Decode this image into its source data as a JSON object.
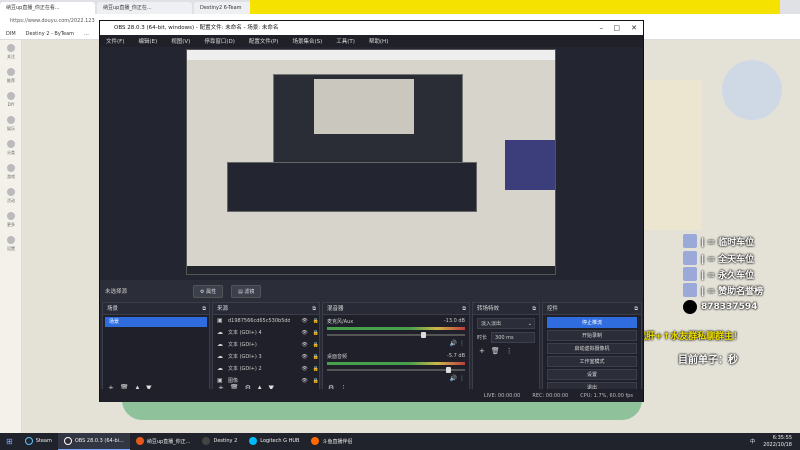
{
  "browser": {
    "tabs": [
      "纳豆up直播_你正在看...",
      "纳豆up直播_你正在...",
      "Destiny2 6-Team"
    ],
    "address": "https://www.douyu.com/2022.123",
    "bookmarks": [
      "DIM",
      "Destiny 2 - ByTeam",
      "..."
    ],
    "sidebar_items": [
      "关注",
      "推荐",
      "DIY",
      "娱乐",
      "分类",
      "游戏",
      "活动",
      "更多",
      "设置"
    ]
  },
  "obs": {
    "title": "OBS 28.0.3 (64-bit, windows) - 配置文件: 未命名 - 场景: 未命名",
    "menu": [
      "文件(F)",
      "编辑(E)",
      "视图(V)",
      "停靠窗口(D)",
      "配置文件(P)",
      "场景集合(S)",
      "工具(T)",
      "帮助(H)"
    ],
    "source_label": "未选择源",
    "toolbar": {
      "props": "属性",
      "filters": "滤镜"
    },
    "scenes": {
      "title": "场景",
      "items": [
        "场景"
      ]
    },
    "sources": {
      "title": "来源",
      "items": [
        {
          "name": "d1987566cd65c530b5ddf",
          "icon": "image-icon"
        },
        {
          "name": "文本 (GDI+) 4",
          "icon": "text-icon"
        },
        {
          "name": "文本 (GDI+)",
          "icon": "text-icon"
        },
        {
          "name": "文本 (GDI+) 3",
          "icon": "text-icon"
        },
        {
          "name": "文本 (GDI+) 2",
          "icon": "text-icon"
        },
        {
          "name": "图像",
          "icon": "image-icon"
        }
      ]
    },
    "mixer": {
      "title": "混音器",
      "channels": [
        {
          "name": "麦克风/Aux",
          "db": "-13.0 dB",
          "level": 0.68
        },
        {
          "name": "桌面音频",
          "db": "-5.7 dB",
          "level": 0.86
        }
      ]
    },
    "transitions": {
      "title": "转场特效",
      "type": "淡入淡出",
      "duration_label": "时长",
      "duration": "300 ms"
    },
    "controls": {
      "title": "控件",
      "buttons": [
        "停止推流",
        "开始录制",
        "启动虚拟摄像机",
        "工作室模式",
        "设置",
        "退出"
      ]
    },
    "status": {
      "live": "LIVE: 00:00:00",
      "rec": "REC: 00:00:00",
      "cpu": "CPU: 1.7%, 60.00 fps"
    }
  },
  "overlay": {
    "badges": [
      "| = 临时车位",
      "| = 全天车位",
      "| = 永久车位",
      "| = 赞助名誉榜"
    ],
    "qq": "878337594",
    "promo": "代肝+↑水友群私聊群主！",
    "current": "目前单子：秒"
  },
  "taskbar": {
    "items": [
      {
        "label": "Steam",
        "color": "#1b2838"
      },
      {
        "label": "OBS 28.0.3 (64-bi...",
        "color": "#302f3a"
      },
      {
        "label": "纳豆up直播_你正...",
        "color": "#e55a1c"
      },
      {
        "label": "Destiny 2",
        "color": "#444"
      },
      {
        "label": "Logitech G HUB",
        "color": "#00b8fc"
      },
      {
        "label": "斗鱼直播伴侣",
        "color": "#ff6a00"
      }
    ],
    "time": "6:35:55",
    "date": "2022/10/18",
    "ime": "中"
  },
  "colors": {
    "obs_accent": "#2f6cde",
    "obs_bg": "#282a36",
    "banner": "#f5e200"
  }
}
